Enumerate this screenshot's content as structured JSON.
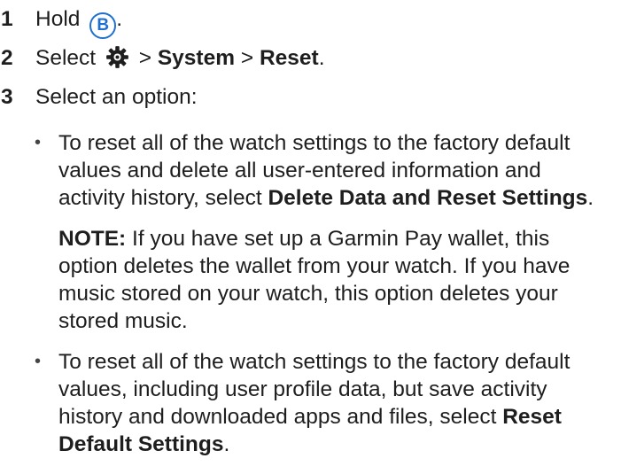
{
  "steps": [
    {
      "number": "1",
      "text_before": "Hold",
      "text_after": "."
    },
    {
      "number": "2",
      "text_before": "Select",
      "sep1": ">",
      "item1": "System",
      "sep2": ">",
      "item2": "Reset",
      "text_after": "."
    },
    {
      "number": "3",
      "text": "Select an option:"
    }
  ],
  "icons": {
    "b_button": "B",
    "gear": "gear-icon"
  },
  "bullets": [
    {
      "text": "To reset all of the watch settings to the factory default values and delete all user-entered information and activity history, select ",
      "bold": "Delete Data and Reset Settings",
      "end": "."
    },
    {
      "text": "To reset all of the watch settings to the factory default values, including user profile data, but save activity history and downloaded apps and files, select ",
      "bold": "Reset Default Settings",
      "end": "."
    }
  ],
  "note": {
    "label": "NOTE:",
    "text": " If you have set up a Garmin Pay wallet, this option deletes the wallet from your watch. If you have music stored on your watch, this option deletes your stored music."
  },
  "colors": {
    "text": "#1e1e1e",
    "accent": "#1f6fd1"
  }
}
